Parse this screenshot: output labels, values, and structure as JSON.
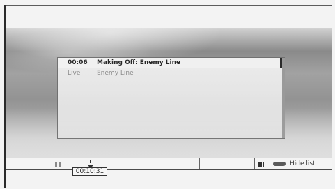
{
  "playlist": {
    "items": [
      {
        "time": "00:06",
        "title": "Making Off: Enemy Line",
        "selected": true
      },
      {
        "time": "Live",
        "title": "Enemy Line",
        "selected": false
      }
    ]
  },
  "controls": {
    "play_state_icon": "pause-icon",
    "seek_marker_icon": "seek-marker-icon",
    "seek_time": "00:10:31",
    "chapter_icon": "chapter-list-icon",
    "hide_list_label": "Hide list"
  },
  "colors": {
    "panel_background": "#ebebeb",
    "panel_border": "#6e6e6e",
    "selected_text": "#1e1e1e",
    "dim_text": "#8c8c8c",
    "bar_background": "#f4f4f4"
  }
}
